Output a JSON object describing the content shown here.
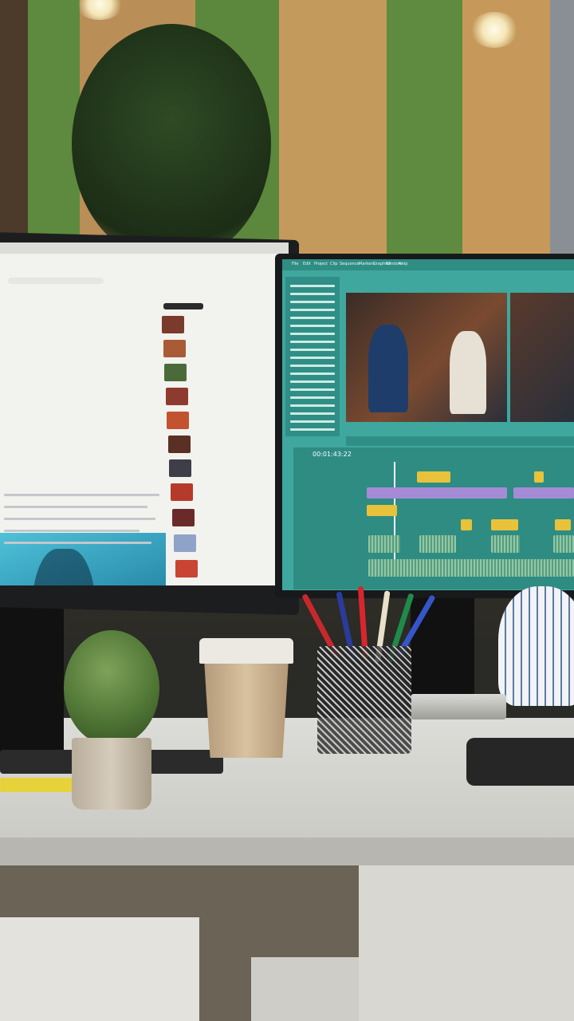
{
  "scene": "office desk with two monitors",
  "video_editor": {
    "menu_items": [
      "File",
      "Edit",
      "Project",
      "Clip",
      "Sequence",
      "Markers",
      "Graphics",
      "Window",
      "Help"
    ],
    "timecode": "00:01:43:22"
  },
  "icons": {
    "play": "play-icon",
    "volume": "volume-icon",
    "fullscreen": "fullscreen-icon"
  },
  "colors": {
    "editor_accent": "#3fa79e",
    "clip_yellow": "#e8c23a",
    "clip_purple": "#a58ad6",
    "wall_green": "#5c8a3d",
    "wall_wood": "#c79a5a"
  }
}
